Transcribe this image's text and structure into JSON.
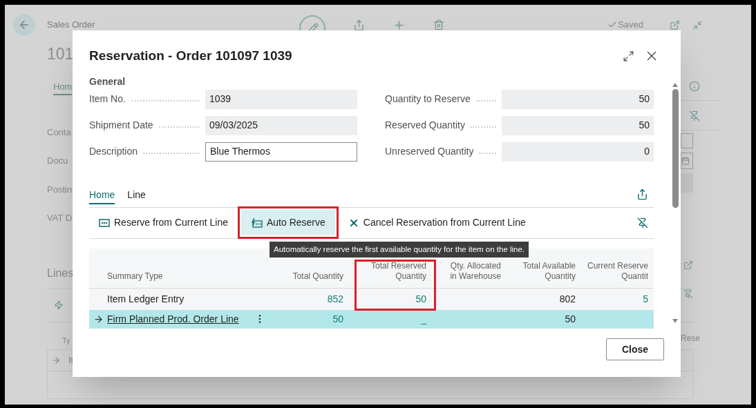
{
  "page": {
    "breadcrumb": "Sales Order",
    "title": "101",
    "saved": "Saved",
    "tab": "Hom",
    "fields": [
      "Conta",
      "Docu",
      "Postin",
      "VAT D"
    ],
    "lines_title": "Lines",
    "lines_header": "Ty",
    "lines_row": "It",
    "right_label": "Rese"
  },
  "dialog": {
    "title": "Reservation - Order 101097 1039",
    "group": "General",
    "fields_left": [
      {
        "label": "Item No.",
        "value": "1039",
        "editable": false
      },
      {
        "label": "Shipment Date",
        "value": "09/03/2025",
        "editable": false
      },
      {
        "label": "Description",
        "value": "Blue Thermos",
        "editable": true
      }
    ],
    "fields_right": [
      {
        "label": "Quantity to Reserve",
        "value": "50",
        "editable": false
      },
      {
        "label": "Reserved Quantity",
        "value": "50",
        "editable": false
      },
      {
        "label": "Unreserved Quantity",
        "value": "0",
        "editable": false
      }
    ],
    "tabs": [
      {
        "label": "Home",
        "selected": true
      },
      {
        "label": "Line",
        "selected": false
      }
    ],
    "actions": [
      {
        "label": "Reserve from Current Line",
        "kind": "reserve",
        "highlighted": false
      },
      {
        "label": "Auto Reserve",
        "kind": "auto",
        "highlighted": true
      },
      {
        "label": "Cancel Reservation from Current Line",
        "kind": "cancel",
        "highlighted": false
      }
    ],
    "tooltip": "Automatically reserve the first available quantity for the item on the line.",
    "table": {
      "columns": [
        {
          "lines": [
            "Summary Type"
          ],
          "kind": "text",
          "highlighted": false
        },
        {
          "lines": [
            "Total Quantity"
          ],
          "kind": "drilldown",
          "highlighted": false
        },
        {
          "lines": [
            "Total Reserved",
            "Quantity"
          ],
          "kind": "drilldown",
          "highlighted": true
        },
        {
          "lines": [
            "Qty. Allocated",
            "in Warehouse"
          ],
          "kind": "number",
          "highlighted": false
        },
        {
          "lines": [
            "Total Available",
            "Quantity"
          ],
          "kind": "number",
          "highlighted": false
        },
        {
          "lines": [
            "Current Reserve",
            "Quantit"
          ],
          "kind": "drilldown",
          "highlighted": false
        }
      ],
      "rows": [
        {
          "selected": false,
          "cells": [
            "Item Ledger Entry",
            "852",
            "50",
            null,
            "802",
            "5"
          ]
        },
        {
          "selected": true,
          "cells": [
            "Firm Planned Prod. Order Line",
            "50",
            "_",
            null,
            "50",
            null
          ]
        }
      ]
    },
    "close_button": "Close"
  }
}
